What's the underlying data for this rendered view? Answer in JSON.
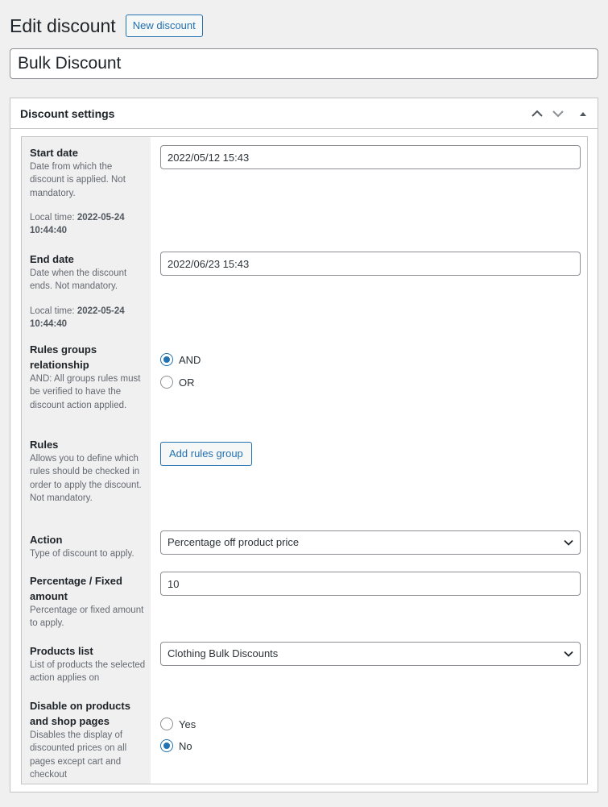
{
  "header": {
    "title": "Edit discount",
    "new_button": "New discount"
  },
  "discount_title": "Bulk Discount",
  "settings": {
    "title": "Discount settings",
    "icons": [
      "chevron-up-icon",
      "chevron-down-icon",
      "triangle-up-icon"
    ],
    "start_date": {
      "label": "Start date",
      "desc": "Date from which the discount is applied. Not mandatory.",
      "local_prefix": "Local time:",
      "local_value": "2022-05-24 10:44:40",
      "value": "2022/05/12 15:43"
    },
    "end_date": {
      "label": "End date",
      "desc": "Date when the discount ends. Not mandatory.",
      "local_prefix": "Local time:",
      "local_value": "2022-05-24 10:44:40",
      "value": "2022/06/23 15:43"
    },
    "relationship": {
      "label": "Rules groups relationship",
      "desc": "AND: All groups rules must be verified to have the discount action applied.",
      "options": [
        "AND",
        "OR"
      ],
      "selected": "AND"
    },
    "rules": {
      "label": "Rules",
      "desc": "Allows you to define which rules should be checked in order to apply the discount. Not mandatory.",
      "button": "Add rules group"
    },
    "action": {
      "label": "Action",
      "desc": "Type of discount to apply.",
      "value": "Percentage off product price"
    },
    "amount": {
      "label": "Percentage / Fixed amount",
      "desc": "Percentage or fixed amount to apply.",
      "value": "10"
    },
    "products": {
      "label": "Products list",
      "desc": "List of products the selected action applies on",
      "value": "Clothing Bulk Discounts"
    },
    "disable": {
      "label": "Disable on products and shop pages",
      "desc": "Disables the display of discounted prices on all pages except cart and checkout",
      "options": [
        "Yes",
        "No"
      ],
      "selected": "No"
    }
  },
  "colors": {
    "accent": "#2271b1",
    "background": "#f0f0f1",
    "border": "#c3c4c7"
  }
}
